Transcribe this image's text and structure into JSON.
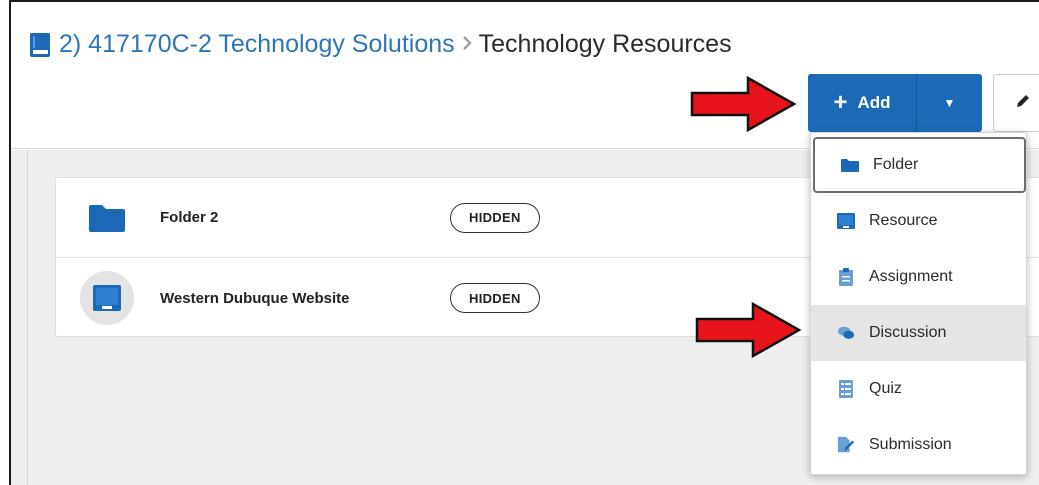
{
  "breadcrumb": {
    "parent": "2) 417170C-2 Technology Solutions",
    "separator": ">",
    "current": "Technology Resources"
  },
  "toolbar": {
    "add_label": "Add",
    "add_plus": "+",
    "caret": "▼"
  },
  "list": [
    {
      "title": "Folder 2",
      "badge": "HIDDEN",
      "icon": "folder-icon"
    },
    {
      "title": "Western Dubuque Website",
      "badge": "HIDDEN",
      "icon": "resource-icon"
    }
  ],
  "add_menu": {
    "items": [
      {
        "label": "Folder",
        "icon": "folder-icon"
      },
      {
        "label": "Resource",
        "icon": "resource-icon"
      },
      {
        "label": "Assignment",
        "icon": "clipboard-icon"
      },
      {
        "label": "Discussion",
        "icon": "chat-bubbles-icon"
      },
      {
        "label": "Quiz",
        "icon": "quiz-list-icon"
      },
      {
        "label": "Submission",
        "icon": "submission-icon"
      }
    ]
  },
  "colors": {
    "primary": "#1c6ab5",
    "link": "#2f76b8",
    "arrow": "#e8141c"
  }
}
